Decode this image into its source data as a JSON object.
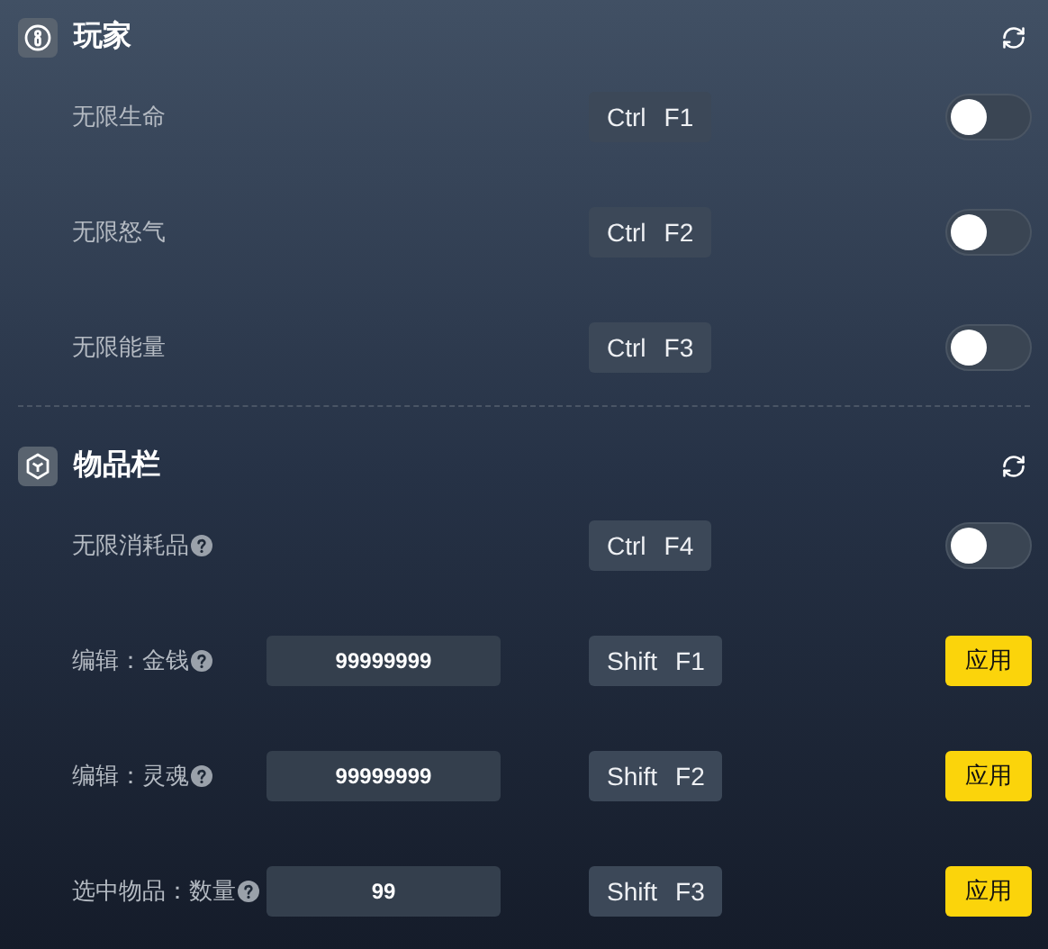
{
  "sections": [
    {
      "title": "玩家",
      "rows": [
        {
          "kind": "toggle",
          "label": "无限生命",
          "help": false,
          "keys": [
            "Ctrl",
            "F1"
          ],
          "on": false
        },
        {
          "kind": "toggle",
          "label": "无限怒气",
          "help": false,
          "keys": [
            "Ctrl",
            "F2"
          ],
          "on": false
        },
        {
          "kind": "toggle",
          "label": "无限能量",
          "help": false,
          "keys": [
            "Ctrl",
            "F3"
          ],
          "on": false
        }
      ]
    },
    {
      "title": "物品栏",
      "rows": [
        {
          "kind": "toggle",
          "label": "无限消耗品",
          "help": true,
          "keys": [
            "Ctrl",
            "F4"
          ],
          "on": false
        },
        {
          "kind": "input",
          "label": "编辑：金钱",
          "help": true,
          "value": "99999999",
          "keys": [
            "Shift",
            "F1"
          ],
          "button": "应用"
        },
        {
          "kind": "input",
          "label": "编辑：灵魂",
          "help": true,
          "value": "99999999",
          "keys": [
            "Shift",
            "F2"
          ],
          "button": "应用"
        },
        {
          "kind": "input",
          "label": "选中物品：数量",
          "help": true,
          "value": "99",
          "keys": [
            "Shift",
            "F3"
          ],
          "button": "应用"
        }
      ]
    }
  ]
}
